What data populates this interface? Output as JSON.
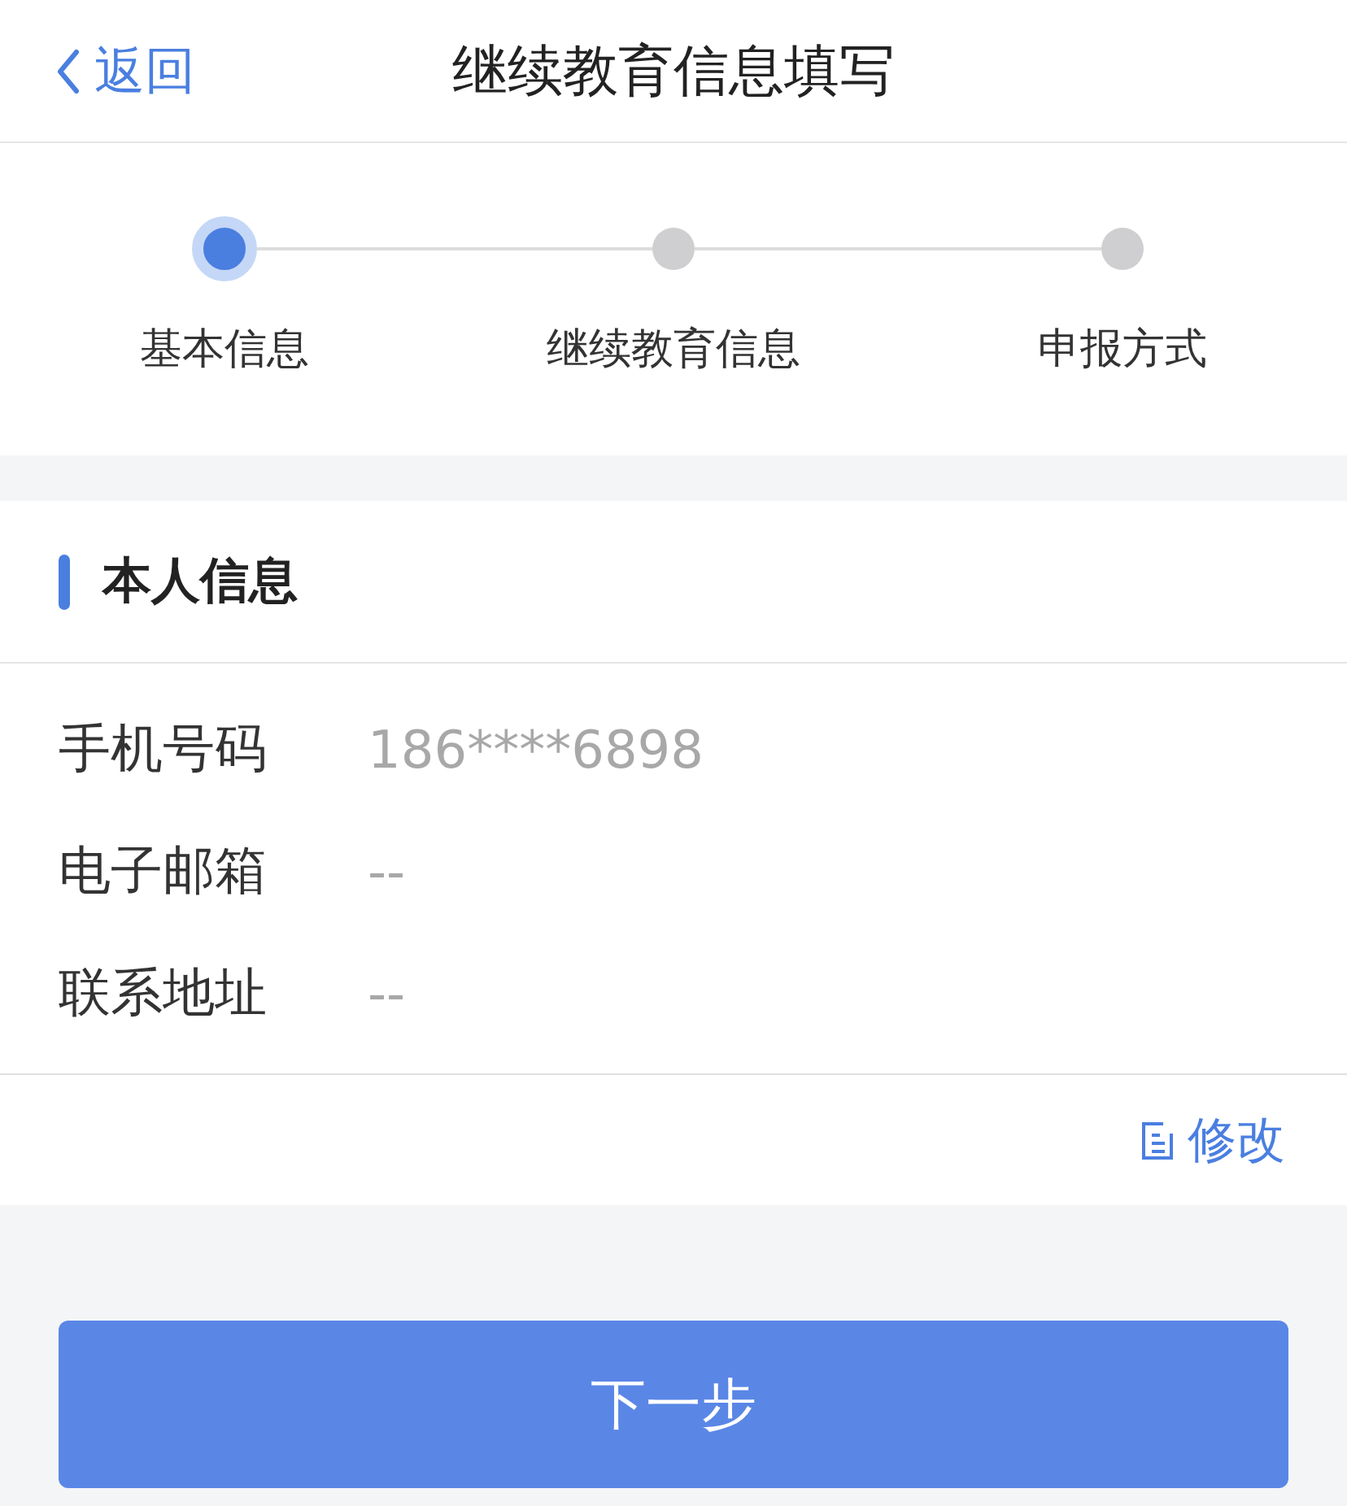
{
  "nav": {
    "back": "返回",
    "title": "继续教育信息填写"
  },
  "steps": [
    {
      "label": "基本信息",
      "selected": true
    },
    {
      "label": "继续教育信息",
      "selected": false
    },
    {
      "label": "申报方式",
      "selected": false
    }
  ],
  "section": {
    "title": "本人信息"
  },
  "fields": [
    {
      "label": "手机号码",
      "value": "186****6898"
    },
    {
      "label": "电子邮箱",
      "value": "--"
    },
    {
      "label": "联系地址",
      "value": "--"
    }
  ],
  "edit": {
    "label": "修改"
  },
  "next_button": {
    "label": "下一步"
  }
}
